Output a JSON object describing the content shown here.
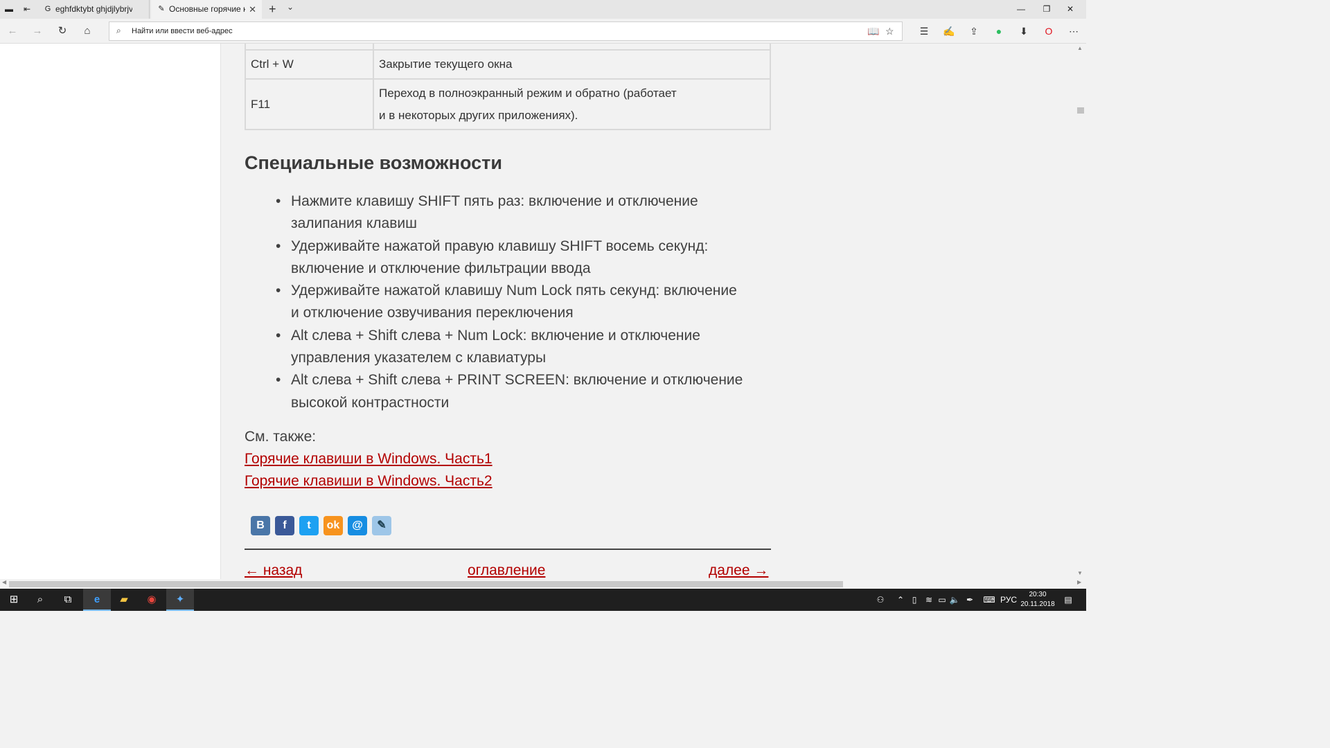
{
  "browser": {
    "tabs": [
      {
        "title": "eghfdktybt ghjdjlybrjv ghb ("
      },
      {
        "title": "Основные горячие кла"
      }
    ],
    "address_placeholder": "Найти или ввести веб-адрес"
  },
  "shortcuts_table": {
    "rows": [
      {
        "key": "Ctrl + W",
        "desc": "Закрытие текущего окна"
      },
      {
        "key": "F11",
        "desc_line1": "Переход в полноэкранный режим и обратно (работает",
        "desc_line2": "и в некоторых других приложениях)."
      }
    ]
  },
  "section": {
    "title": "Специальные возможности",
    "items": [
      {
        "line1": "Нажмите клавишу SHIFT пять раз: включение и отключение",
        "line2": "залипания клавиш"
      },
      {
        "line1": "Удерживайте нажатой правую клавишу SHIFT восемь секунд:",
        "line2": "включение и отключение фильтрации ввода"
      },
      {
        "line1": "Удерживайте нажатой клавишу Num Lock пять секунд: включение",
        "line2": "и отключение озвучивания переключения"
      },
      {
        "line1": "Alt слева + Shift слева + Num Lock: включение и отключение",
        "line2": "управления указателем с клавиатуры"
      },
      {
        "line1": "Alt слева + Shift слева + PRINT SCREEN: включение и отключение",
        "line2": "высокой контрастности"
      }
    ]
  },
  "see_also": {
    "label": "См. также:",
    "links": [
      "Горячие клавиши в Windows. Часть1",
      "Горячие клавиши в Windows. Часть2"
    ]
  },
  "social": {
    "icons": [
      "vk-icon",
      "facebook-icon",
      "twitter-icon",
      "odnoklassniki-icon",
      "mailru-icon",
      "livejournal-icon"
    ],
    "colors": {
      "vk": "#4a76a8",
      "facebook": "#3b5998",
      "twitter": "#1da1f2",
      "odnoklassniki": "#f7931e",
      "mailru": "#168de2",
      "livejournal": "#9ec6e8"
    }
  },
  "pager": {
    "prev": "← назад",
    "toc": "оглавление",
    "next": "далее →"
  },
  "taskbar": {
    "lang": "РУС",
    "time": "20:30",
    "date": "20.11.2018"
  },
  "colors": {
    "link": "#b30000",
    "text": "#404040",
    "page_bg": "#f2f2f2"
  }
}
